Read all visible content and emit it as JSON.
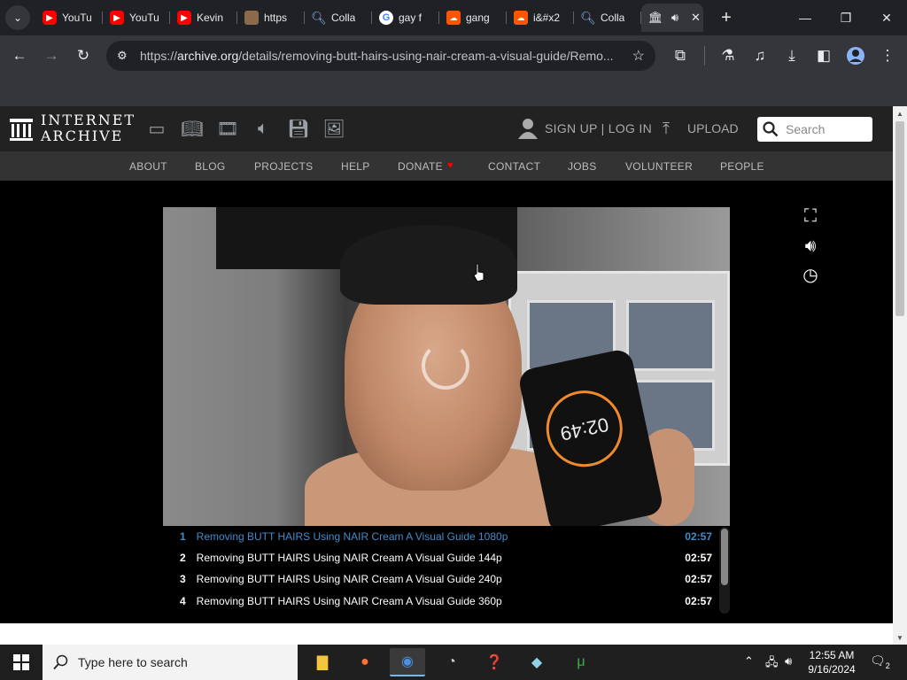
{
  "browser": {
    "tabs": [
      {
        "title": "YouTu",
        "icon": "youtube-icon"
      },
      {
        "title": "YouTu",
        "icon": "youtube-icon"
      },
      {
        "title": "Kevin",
        "icon": "youtube-icon"
      },
      {
        "title": "https",
        "icon": "image-icon"
      },
      {
        "title": "Colla",
        "icon": "search-icon"
      },
      {
        "title": "gay f",
        "icon": "google-icon"
      },
      {
        "title": "gang",
        "icon": "soundcloud-icon"
      },
      {
        "title": "i&#x2",
        "icon": "soundcloud-icon"
      },
      {
        "title": "Colla",
        "icon": "search-icon"
      }
    ],
    "url_host": "archive.org",
    "url_prefix": "https://",
    "url_path": "/details/removing-butt-hairs-using-nair-cream-a-visual-guide/Remo..."
  },
  "ia": {
    "logo_line1": "INTERNET",
    "logo_line2": "ARCHIVE",
    "signup": "SIGN UP | LOG IN",
    "upload": "UPLOAD",
    "search_placeholder": "Search",
    "nav": [
      "ABOUT",
      "BLOG",
      "PROJECTS",
      "HELP",
      "DONATE",
      "CONTACT",
      "JOBS",
      "VOLUNTEER",
      "PEOPLE"
    ],
    "heart_color": "#ff0000"
  },
  "video": {
    "phone_time": "02:49"
  },
  "playlist": [
    {
      "num": "1",
      "title": "Removing BUTT HAIRS Using NAIR Cream A Visual Guide 1080p",
      "duration": "02:57",
      "active": true
    },
    {
      "num": "2",
      "title": "Removing BUTT HAIRS Using NAIR Cream A Visual Guide 144p",
      "duration": "02:57",
      "active": false
    },
    {
      "num": "3",
      "title": "Removing BUTT HAIRS Using NAIR Cream A Visual Guide 240p",
      "duration": "02:57",
      "active": false
    },
    {
      "num": "4",
      "title": "Removing BUTT HAIRS Using NAIR Cream A Visual Guide 360p",
      "duration": "02:57",
      "active": false
    }
  ],
  "taskbar": {
    "search_placeholder": "Type here to search",
    "time": "12:55 AM",
    "date": "9/16/2024",
    "notif_count": "2"
  }
}
